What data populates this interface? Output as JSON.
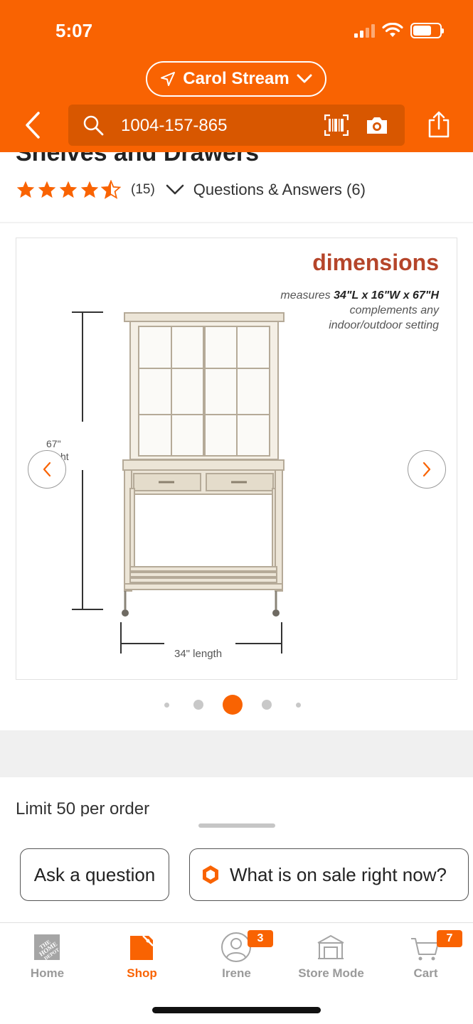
{
  "status_bar": {
    "time": "5:07"
  },
  "header": {
    "store_name": "Carol Stream",
    "search_query": "1004-157-865",
    "accent_color": "#f96302"
  },
  "product": {
    "title_fragment": "Shelves and Drawers",
    "rating": 4.5,
    "review_count": "(15)",
    "questions_link": "Questions & Answers (6)"
  },
  "image_carousel": {
    "heading": "dimensions",
    "measures_prefix": "measures",
    "measures_value": "34\"L x 16\"W x 67\"H",
    "line2": "complements any",
    "line3": "indoor/outdoor setting",
    "height_label_1": "67\"",
    "height_label_2": "ht",
    "length_label": "34\" length",
    "active_index": 2,
    "total_images": 5
  },
  "order_info": {
    "limit_text": "Limit 50 per order"
  },
  "chips": {
    "ask": "Ask a question",
    "sale": "What is on sale right now?"
  },
  "tabbar": {
    "home": "Home",
    "shop": "Shop",
    "account": "Irene",
    "account_badge": "3",
    "store_mode": "Store Mode",
    "cart": "Cart",
    "cart_badge": "7"
  }
}
